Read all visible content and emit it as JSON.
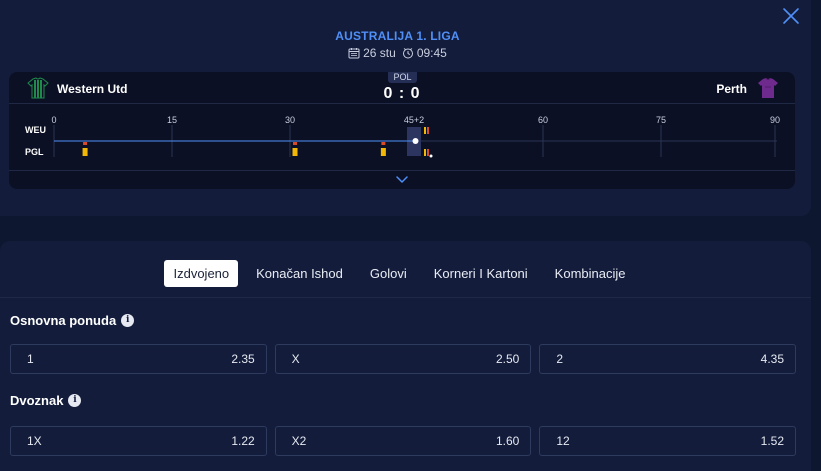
{
  "header": {
    "league": "AUSTRALIJA 1. LIGA",
    "date": "26 stu",
    "time": "09:45",
    "close_icon": "close-icon"
  },
  "match": {
    "home_team": "Western Utd",
    "away_team": "Perth",
    "home_abbr": "WEU",
    "away_abbr": "PGL",
    "period": "POL",
    "score": "0 : 0",
    "colors": {
      "home_kit": "#1f8a4c",
      "away_kit": "#6e2a8c",
      "accent": "#4f8ff7"
    }
  },
  "timeline": {
    "ticks": [
      "0",
      "15",
      "30",
      "45+2",
      "60",
      "75",
      "90"
    ],
    "current_minute": 45,
    "events": [
      {
        "team": "away",
        "type": "yellow-card",
        "minute": 2
      },
      {
        "team": "away",
        "type": "yellow-card",
        "minute": 30
      },
      {
        "team": "away",
        "type": "yellow-card",
        "minute": 41
      },
      {
        "team": "home",
        "type": "cards-marker",
        "minute": 47
      },
      {
        "team": "away",
        "type": "cards-marker",
        "minute": 47
      }
    ]
  },
  "tabs": [
    {
      "label": "Izdvojeno",
      "active": true
    },
    {
      "label": "Konačan Ishod",
      "active": false
    },
    {
      "label": "Golovi",
      "active": false
    },
    {
      "label": "Korneri I Kartoni",
      "active": false
    },
    {
      "label": "Kombinacije",
      "active": false
    }
  ],
  "markets": [
    {
      "title": "Osnovna ponuda",
      "odds": [
        {
          "label": "1",
          "value": "2.35"
        },
        {
          "label": "X",
          "value": "2.50"
        },
        {
          "label": "2",
          "value": "4.35"
        }
      ]
    },
    {
      "title": "Dvoznak",
      "odds": [
        {
          "label": "1X",
          "value": "1.22"
        },
        {
          "label": "X2",
          "value": "1.60"
        },
        {
          "label": "12",
          "value": "1.52"
        }
      ]
    }
  ]
}
